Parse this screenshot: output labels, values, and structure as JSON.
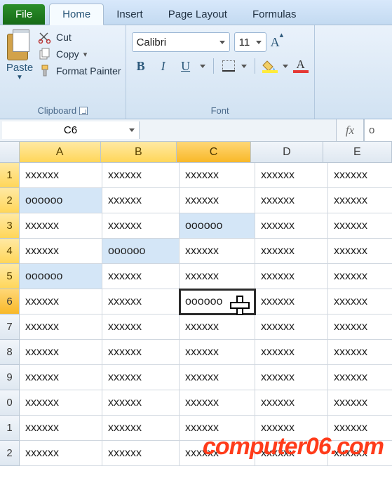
{
  "tabs": {
    "file": "File",
    "home": "Home",
    "insert": "Insert",
    "pagelayout": "Page Layout",
    "formulas": "Formulas"
  },
  "clipboard": {
    "paste": "Paste",
    "cut": "Cut",
    "copy": "Copy",
    "copy_drop": "▾",
    "format_painter": "Format Painter",
    "group_label": "Clipboard"
  },
  "font": {
    "name": "Calibri",
    "size": "11",
    "bold": "B",
    "italic": "I",
    "underline": "U",
    "group_label": "Font",
    "bigA": "A",
    "caret": "▾"
  },
  "namebox": "C6",
  "fx": "fx",
  "formula_value": "o",
  "col_headers": [
    "A",
    "B",
    "C",
    "D",
    "E"
  ],
  "selected_cols": [
    0,
    1,
    2
  ],
  "active_col": 2,
  "rows": [
    "1",
    "2",
    "3",
    "4",
    "5",
    "6",
    "7",
    "8",
    "9",
    "0",
    "1",
    "2"
  ],
  "active_row": 5,
  "cells": [
    [
      {
        "v": "xxxxxx"
      },
      {
        "v": "xxxxxx"
      },
      {
        "v": "xxxxxx"
      },
      {
        "v": "xxxxxx"
      },
      {
        "v": "xxxxxx"
      }
    ],
    [
      {
        "v": "oooooo",
        "hl": true
      },
      {
        "v": "xxxxxx"
      },
      {
        "v": "xxxxxx"
      },
      {
        "v": "xxxxxx"
      },
      {
        "v": "xxxxxx"
      }
    ],
    [
      {
        "v": "xxxxxx"
      },
      {
        "v": "xxxxxx"
      },
      {
        "v": "oooooo",
        "hl": true
      },
      {
        "v": "xxxxxx"
      },
      {
        "v": "xxxxxx"
      }
    ],
    [
      {
        "v": "xxxxxx"
      },
      {
        "v": "oooooo",
        "hl": true
      },
      {
        "v": "xxxxxx"
      },
      {
        "v": "xxxxxx"
      },
      {
        "v": "xxxxxx"
      }
    ],
    [
      {
        "v": "oooooo",
        "hl": true
      },
      {
        "v": "xxxxxx"
      },
      {
        "v": "xxxxxx"
      },
      {
        "v": "xxxxxx"
      },
      {
        "v": "xxxxxx"
      }
    ],
    [
      {
        "v": "xxxxxx"
      },
      {
        "v": "xxxxxx"
      },
      {
        "v": "oooooo",
        "active": true
      },
      {
        "v": "xxxxxx"
      },
      {
        "v": "xxxxxx"
      }
    ],
    [
      {
        "v": "xxxxxx"
      },
      {
        "v": "xxxxxx"
      },
      {
        "v": "xxxxxx"
      },
      {
        "v": "xxxxxx"
      },
      {
        "v": "xxxxxx"
      }
    ],
    [
      {
        "v": "xxxxxx"
      },
      {
        "v": "xxxxxx"
      },
      {
        "v": "xxxxxx"
      },
      {
        "v": "xxxxxx"
      },
      {
        "v": "xxxxxx"
      }
    ],
    [
      {
        "v": "xxxxxx"
      },
      {
        "v": "xxxxxx"
      },
      {
        "v": "xxxxxx"
      },
      {
        "v": "xxxxxx"
      },
      {
        "v": "xxxxxx"
      }
    ],
    [
      {
        "v": "xxxxxx"
      },
      {
        "v": "xxxxxx"
      },
      {
        "v": "xxxxxx"
      },
      {
        "v": "xxxxxx"
      },
      {
        "v": "xxxxxx"
      }
    ],
    [
      {
        "v": "xxxxxx"
      },
      {
        "v": "xxxxxx"
      },
      {
        "v": "xxxxxx"
      },
      {
        "v": "xxxxxx"
      },
      {
        "v": "xxxxxx"
      }
    ],
    [
      {
        "v": "xxxxxx"
      },
      {
        "v": "xxxxxx"
      },
      {
        "v": "xxxxxx"
      },
      {
        "v": "xxxxxx"
      },
      {
        "v": "xxxxxx"
      }
    ]
  ],
  "watermark": "computer06.com"
}
